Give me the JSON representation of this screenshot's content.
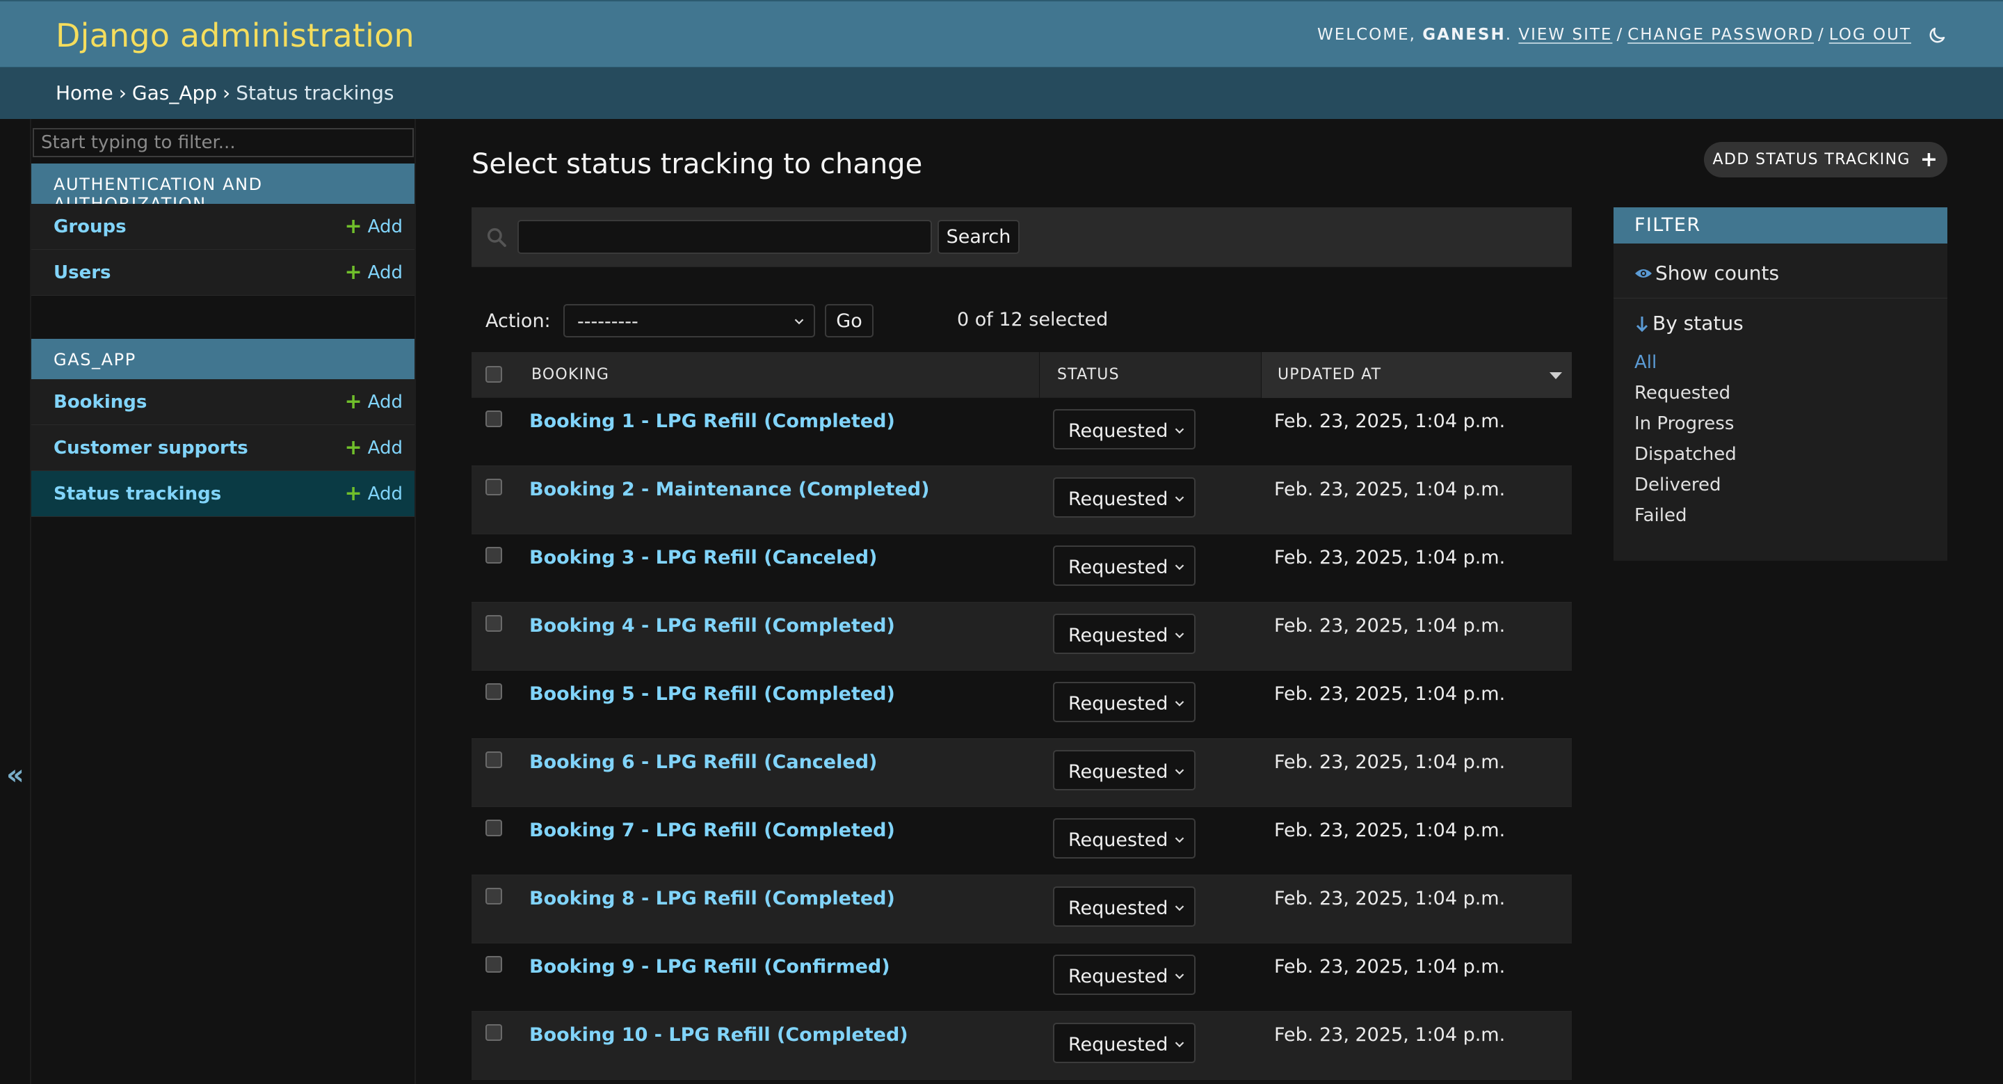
{
  "header": {
    "site_name": "Django administration",
    "welcome": "WELCOME,",
    "username": "GANESH",
    "view_site": "VIEW SITE",
    "change_password": "CHANGE PASSWORD",
    "log_out": "LOG OUT"
  },
  "breadcrumbs": {
    "home": "Home",
    "app": "Gas_App",
    "current": "Status trackings",
    "separator": "›"
  },
  "sidebar": {
    "filter_placeholder": "Start typing to filter...",
    "toggle_label": "«",
    "modules": [
      {
        "caption": "AUTHENTICATION AND AUTHORIZATION",
        "models": [
          {
            "name": "Groups",
            "add": "Add"
          },
          {
            "name": "Users",
            "add": "Add"
          }
        ]
      },
      {
        "caption": "GAS_APP",
        "models": [
          {
            "name": "Bookings",
            "add": "Add"
          },
          {
            "name": "Customer supports",
            "add": "Add"
          },
          {
            "name": "Status trackings",
            "add": "Add",
            "current": true
          }
        ]
      }
    ]
  },
  "content": {
    "title": "Select status tracking to change",
    "add_button": "ADD STATUS TRACKING",
    "search_button": "Search",
    "search_value": "",
    "action_label": "Action:",
    "action_selected": "---------",
    "go_button": "Go",
    "counter": "0 of 12 selected",
    "columns": [
      "BOOKING",
      "STATUS",
      "UPDATED AT"
    ],
    "rows": [
      {
        "booking": "Booking 1 - LPG Refill (Completed)",
        "status": "Requested",
        "updated_at": "Feb. 23, 2025, 1:04 p.m."
      },
      {
        "booking": "Booking 2 - Maintenance (Completed)",
        "status": "Requested",
        "updated_at": "Feb. 23, 2025, 1:04 p.m."
      },
      {
        "booking": "Booking 3 - LPG Refill (Canceled)",
        "status": "Requested",
        "updated_at": "Feb. 23, 2025, 1:04 p.m."
      },
      {
        "booking": "Booking 4 - LPG Refill (Completed)",
        "status": "Requested",
        "updated_at": "Feb. 23, 2025, 1:04 p.m."
      },
      {
        "booking": "Booking 5 - LPG Refill (Completed)",
        "status": "Requested",
        "updated_at": "Feb. 23, 2025, 1:04 p.m."
      },
      {
        "booking": "Booking 6 - LPG Refill (Canceled)",
        "status": "Requested",
        "updated_at": "Feb. 23, 2025, 1:04 p.m."
      },
      {
        "booking": "Booking 7 - LPG Refill (Completed)",
        "status": "Requested",
        "updated_at": "Feb. 23, 2025, 1:04 p.m."
      },
      {
        "booking": "Booking 8 - LPG Refill (Completed)",
        "status": "Requested",
        "updated_at": "Feb. 23, 2025, 1:04 p.m."
      },
      {
        "booking": "Booking 9 - LPG Refill (Confirmed)",
        "status": "Requested",
        "updated_at": "Feb. 23, 2025, 1:04 p.m."
      },
      {
        "booking": "Booking 10 - LPG Refill (Completed)",
        "status": "Requested",
        "updated_at": "Feb. 23, 2025, 1:04 p.m."
      }
    ]
  },
  "filter": {
    "title": "FILTER",
    "show_counts": "Show counts",
    "by_status": "By status",
    "choices": [
      "All",
      "Requested",
      "In Progress",
      "Dispatched",
      "Delivered",
      "Failed"
    ],
    "selected": "All"
  },
  "colors": {
    "header_bg": "#417690",
    "site_name": "#f5dd5d",
    "breadcrumbs_bg": "#264b5d",
    "link": "#81d4fa",
    "add_plus": "#70bf2b",
    "page_bg": "#121212"
  },
  "icons": [
    "moon-icon",
    "plus-icon",
    "search-icon",
    "chevron-down-icon",
    "eye-icon",
    "arrow-down-icon",
    "sort-desc-icon"
  ]
}
